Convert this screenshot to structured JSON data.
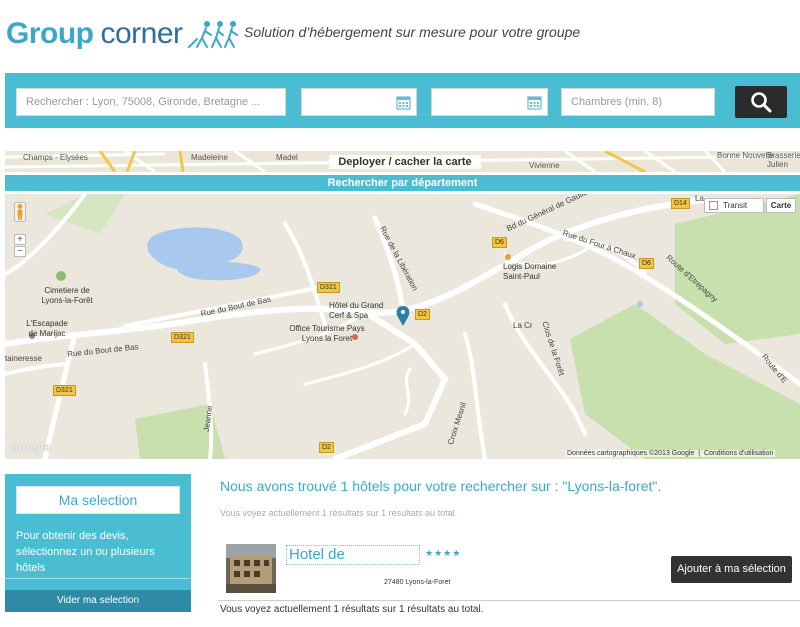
{
  "header": {
    "logo_group": "Group",
    "logo_corner": "corner",
    "tagline": "Solution d’hébergement sur mesure pour votre groupe"
  },
  "search": {
    "location_placeholder": "Rechercher : Lyon, 75008, Gironde, Bretagne ...",
    "arrival_value": "",
    "departure_value": "",
    "rooms_placeholder": "Chambres (min. 8)",
    "icons": {
      "calendar": "calendar-icon",
      "search": "search-icon"
    }
  },
  "map_strip": {
    "toggle_label": "Deployer / cacher la carte",
    "labels": [
      "Champs - Elysées",
      "Madeleine",
      "Madel",
      "Vivienne",
      "Bonne Nouvelle",
      "Brasserie Julien"
    ]
  },
  "department_bar": {
    "label": "Rechercher par département"
  },
  "map": {
    "places": [
      "Cimetiere de Lyons-la-Forêt",
      "L'Escapade de Marijac",
      "Hôtel du Grand Cerf & Spa",
      "Office Tourisme Pays Lyons la Foret",
      "Logis Domaine Saint-Paul"
    ],
    "roads": [
      "Rue du Bout de Bas",
      "Rue du Bout de Bas",
      "Rue de la Libération",
      "Bd du Général de Gaulle",
      "Rue du Four à Chaux",
      "Route d'Etrepagny",
      "Clos de la Forêt",
      "Route d'E",
      "Croix Mesnil",
      "Jeanne",
      "taineresse",
      "La Cr",
      "La"
    ],
    "badges": [
      "D321",
      "D321",
      "D321",
      "D2",
      "D2",
      "D6",
      "D6",
      "D14"
    ],
    "zoom_in": "+",
    "zoom_out": "−",
    "transit_label": "Transit",
    "map_type_label": "Carte",
    "google_label": "Google",
    "copyright": "Données cartographiques ©2013 Google",
    "terms": "Conditions d'utilisation",
    "colors": {
      "background": "#ebe7dc",
      "park": "#c8dfae",
      "water": "#a8c8ee",
      "road": "#ffffff",
      "badge": "#f5c542"
    }
  },
  "sidebar": {
    "title": "Ma selection",
    "text": "Pour obtenir des devis, sélectionnez un ou plusieurs hôtels",
    "clear_label": "Vider ma selection"
  },
  "results": {
    "title": "Nous avons trouvé 1 hôtels pour votre rechercher sur : \"Lyons-la-foret\".",
    "info_top": "Vous voyez actuellement 1 résultats sur 1 résultats au total.",
    "info_bottom": "Vous voyez actuellement 1 résultats sur 1 résultats au total.",
    "hotels": [
      {
        "name": "Hotel de",
        "stars": "★★★★",
        "address": "27480 Lyons-la-Foret",
        "add_label": "Ajouter à ma sélection"
      }
    ]
  },
  "colors": {
    "accent": "#4bbdd3",
    "accent_dark": "#2e8aa5",
    "logo_light": "#3aa9c9",
    "logo_dark": "#2f6f9e",
    "button_dark": "#333333"
  }
}
